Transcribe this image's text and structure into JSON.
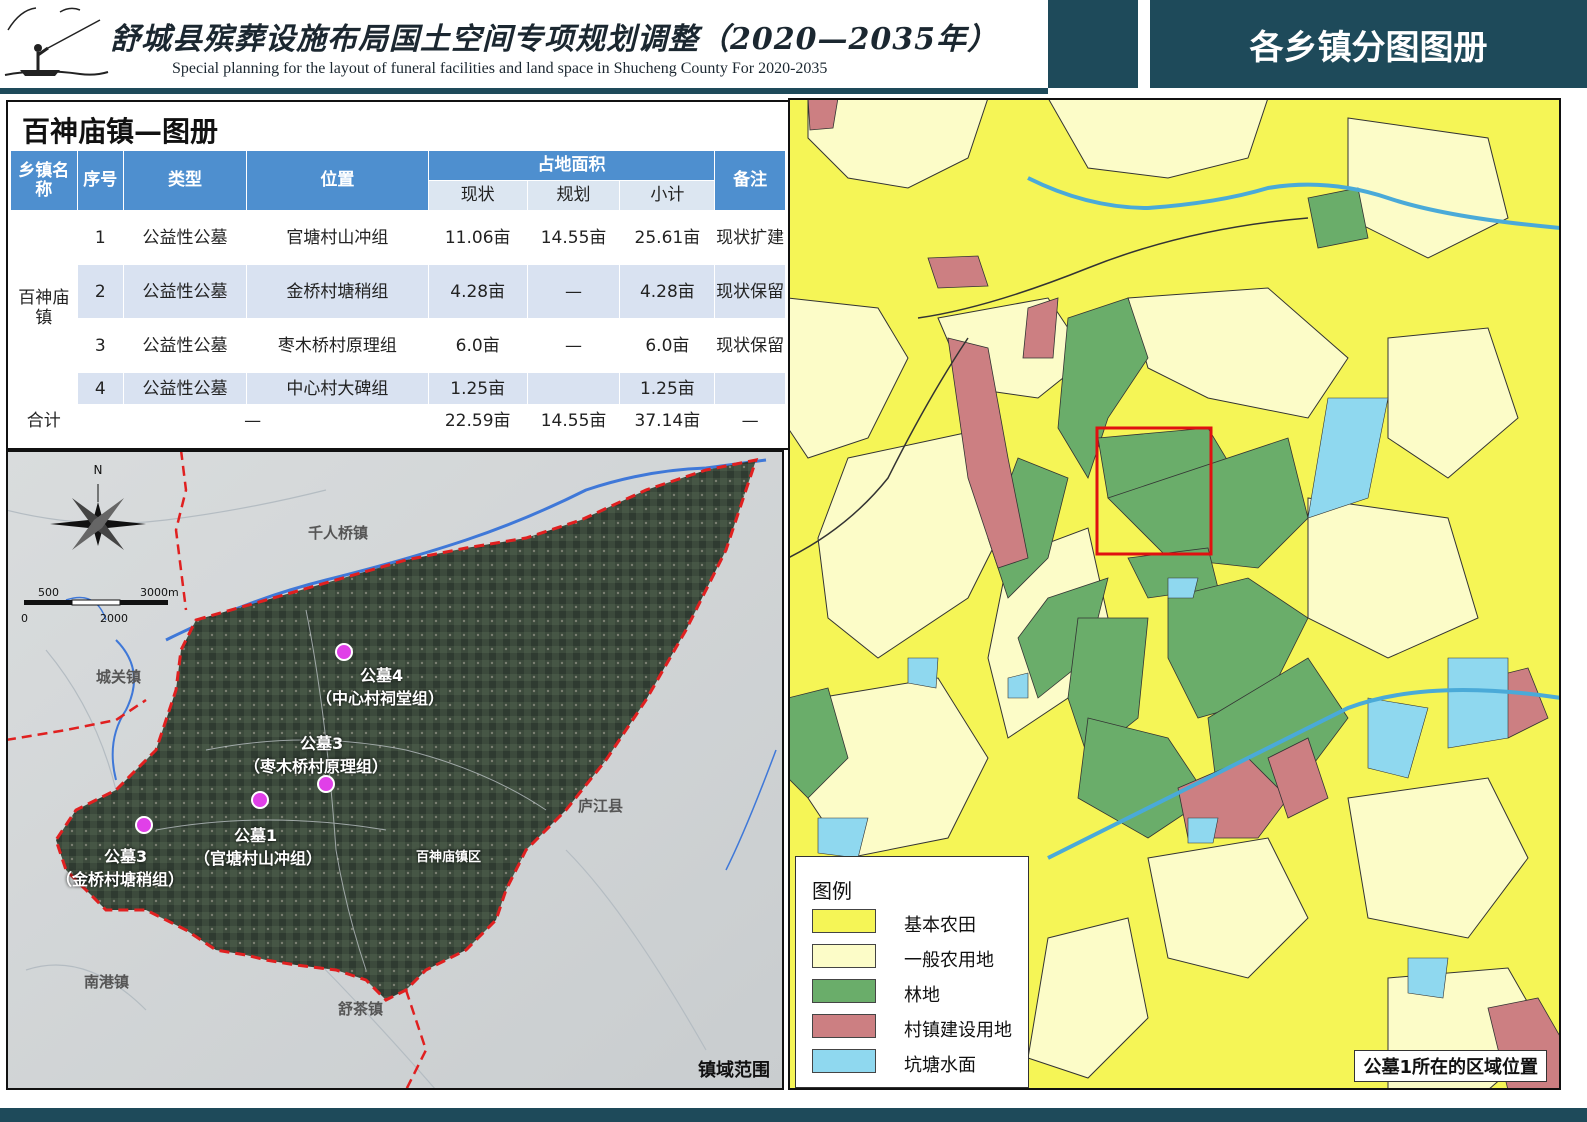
{
  "header": {
    "title_cn": "舒城县殡葬设施布局国土空间专项规划调整（2020—2035年）",
    "title_en": "Special planning for the layout of funeral facilities and land space in Shucheng County For 2020-2035",
    "atlas_title": "各乡镇分图图册"
  },
  "table": {
    "title": "百神庙镇—图册",
    "headers": {
      "town": "乡镇名称",
      "seq": "序号",
      "type": "类型",
      "location": "位置",
      "area": "占地面积",
      "current": "现状",
      "planned": "规划",
      "subtotal": "小计",
      "note": "备注"
    },
    "town_name": "百神庙镇",
    "rows": [
      {
        "seq": "1",
        "type": "公益性公墓",
        "location": "官塘村山冲组",
        "current": "11.06亩",
        "planned": "14.55亩",
        "subtotal": "25.61亩",
        "note": "现状扩建"
      },
      {
        "seq": "2",
        "type": "公益性公墓",
        "location": "金桥村塘稍组",
        "current": "4.28亩",
        "planned": "—",
        "subtotal": "4.28亩",
        "note": "现状保留"
      },
      {
        "seq": "3",
        "type": "公益性公墓",
        "location": "枣木桥村原理组",
        "current": "6.0亩",
        "planned": "—",
        "subtotal": "6.0亩",
        "note": "现状保留"
      },
      {
        "seq": "4",
        "type": "公益性公墓",
        "location": "中心村大碑组",
        "current": "1.25亩",
        "planned": "",
        "subtotal": "1.25亩",
        "note": ""
      }
    ],
    "total": {
      "label": "合计",
      "merged": "—",
      "current": "22.59亩",
      "planned": "14.55亩",
      "subtotal": "37.14亩",
      "note": "—"
    }
  },
  "overview_map": {
    "compass_n": "N",
    "scale": {
      "label_500": "500",
      "label_3000": "3000m",
      "label_0": "0",
      "label_2000": "2000"
    },
    "neighbors": {
      "north": "千人桥镇",
      "west": "城关镇",
      "east": "庐江县",
      "southwest": "南港镇",
      "south": "舒茶镇"
    },
    "town_seat": "百神庙镇区",
    "markers": [
      {
        "name": "公墓4",
        "place": "（中心村祠堂组）"
      },
      {
        "name": "公墓3",
        "place": "（枣木桥村原理组）"
      },
      {
        "name": "公墓1",
        "place": "（官塘村山冲组）"
      },
      {
        "name": "公墓3",
        "place": "（金桥村塘稍组）"
      }
    ],
    "caption": "镇域范围",
    "marker_color": "#e040e8",
    "boundary_color": "#e02020"
  },
  "zoom_map": {
    "legend_title": "图例",
    "legend": [
      {
        "label": "基本农田",
        "color": "#f5f556"
      },
      {
        "label": "一般农用地",
        "color": "#fcfcc8"
      },
      {
        "label": "林地",
        "color": "#6aad6a"
      },
      {
        "label": "村镇建设用地",
        "color": "#cc7f82"
      },
      {
        "label": "坑塘水面",
        "color": "#8fd8ef"
      }
    ],
    "caption": "公墓1所在的区域位置",
    "highlight_color": "#e01010"
  }
}
